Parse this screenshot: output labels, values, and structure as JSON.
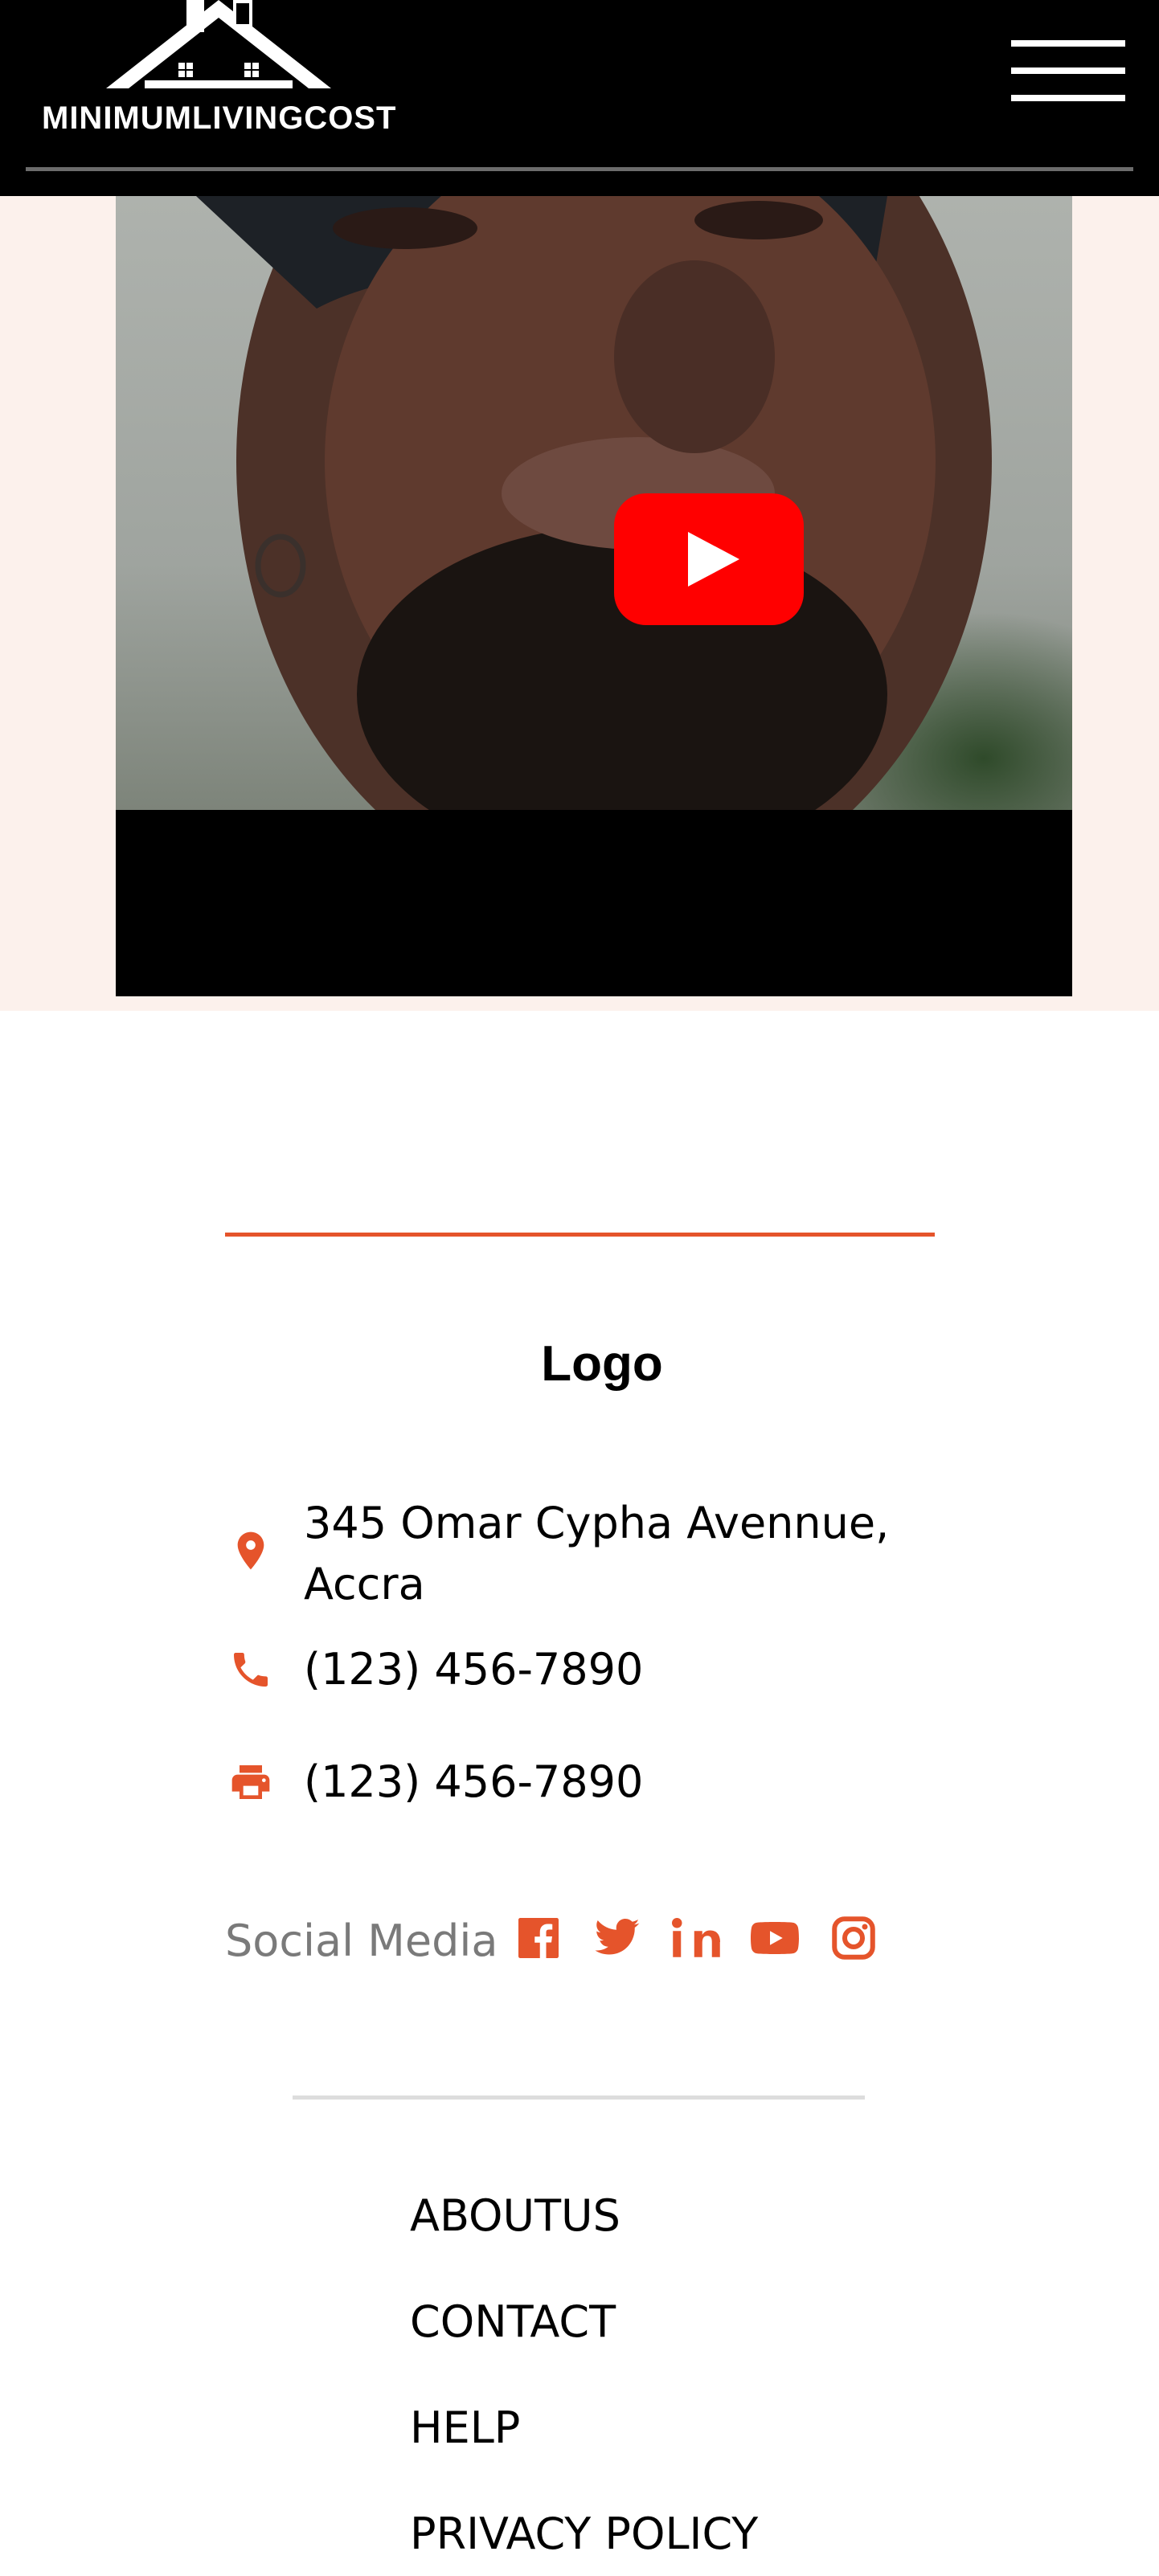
{
  "header": {
    "logo_text": "MINIMUMLIVINGCOST",
    "menu_icon": "hamburger-menu-icon"
  },
  "video": {
    "play_icon": "youtube-play-icon",
    "play_color": "#ff0000"
  },
  "footer": {
    "logo_label": "Logo",
    "accent_color": "#e5542b",
    "contacts": [
      {
        "icon": "location-pin-icon",
        "text": "345 Omar Cypha Avennue, Accra"
      },
      {
        "icon": "phone-icon",
        "text": "(123) 456-7890"
      },
      {
        "icon": "printer-icon",
        "text": "(123) 456-7890"
      }
    ],
    "social": {
      "label": "Social Media",
      "icons": [
        "facebook-icon",
        "twitter-icon",
        "linkedin-icon",
        "youtube-icon",
        "instagram-icon"
      ]
    },
    "links": [
      "ABOUTUS",
      "CONTACT",
      "HELP",
      "PRIVACY POLICY"
    ]
  }
}
